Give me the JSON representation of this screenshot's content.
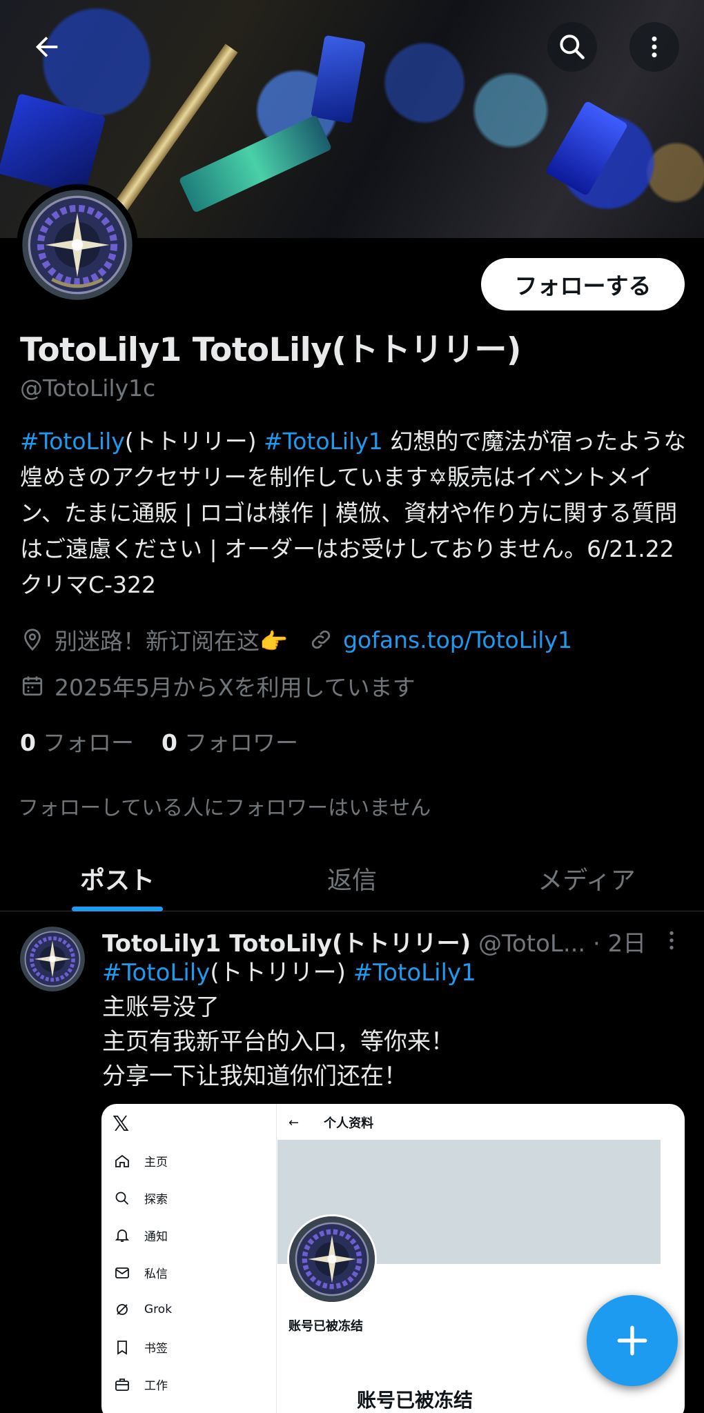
{
  "profile": {
    "display_name": "TotoLily1 TotoLily(トトリリー)",
    "handle": "@TotoLily1c",
    "follow_label": "フォローする",
    "bio": {
      "tag1": "#TotoLily",
      "text1": "(トトリリー) ",
      "tag2": "#TotoLily1",
      "text2": " 幻想的で魔法が宿ったような煌めきのアクセサリーを制作しています✡販売はイベントメイン、たまに通販 | ロゴは様作 | 模倣、資材や作り方に関する質問はご遠慮ください | オーダーはお受けしておりません。6/21.22クリマC-322"
    },
    "location": "别迷路！新订阅在这👉",
    "link": "gofans.top/TotoLily1",
    "joined": "2025年5月からXを利用しています",
    "following_count": "0",
    "following_label": "フォロー",
    "followers_count": "0",
    "followers_label": "フォロワー",
    "no_followers_note": "フォローしている人にフォロワーはいません"
  },
  "tabs": [
    {
      "label": "ポスト",
      "active": true
    },
    {
      "label": "返信",
      "active": false
    },
    {
      "label": "メディア",
      "active": false
    }
  ],
  "post": {
    "name": "TotoLily1 TotoLily(トトリリー)",
    "handle_time": " @TotoL... · 2日",
    "tag1": "#TotoLily",
    "text1": "(トトリリー) ",
    "tag2": "#TotoLily1",
    "line2": "主账号没了",
    "line3": "主页有我新平台的入口，等你来！",
    "line4": "分享一下让我知道你们还在！"
  },
  "embed": {
    "logo": "𝕏",
    "nav": [
      "主页",
      "探索",
      "通知",
      "私信",
      "Grok",
      "书签",
      "工作"
    ],
    "nav_icons": [
      "home-icon",
      "search-icon",
      "bell-icon",
      "mail-icon",
      "grok-icon",
      "bookmark-icon",
      "briefcase-icon"
    ],
    "back_arrow": "←",
    "title": "个人资料",
    "frozen_small": "账号已被冻结",
    "frozen_big": "账号已被冻结"
  },
  "colors": {
    "accent": "#1d9bf0",
    "background": "#000000",
    "secondary_text": "#71767b"
  },
  "icons": {
    "header": [
      "back-arrow-icon",
      "search-icon",
      "more-vertical-icon"
    ],
    "fab": "plus-icon"
  }
}
